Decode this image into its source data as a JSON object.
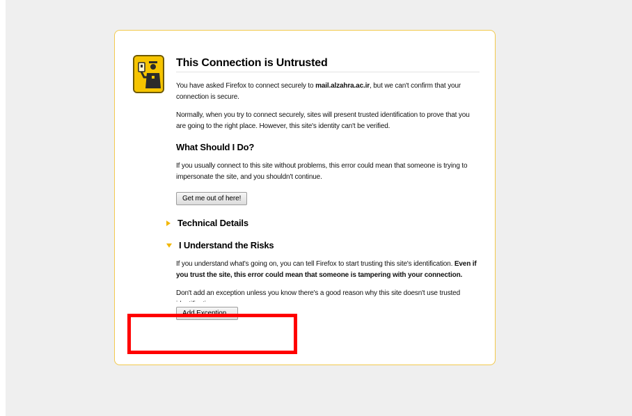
{
  "title": "This Connection is Untrusted",
  "intro": {
    "prefix": "You have asked Firefox to connect securely to ",
    "domain": "mail.alzahra.ac.ir",
    "suffix": ", but we can't confirm that your connection is secure."
  },
  "normally_text": "Normally, when you try to connect securely, sites will present trusted identification to prove that you are going to the right place. However, this site's identity can't be verified.",
  "what_should_heading": "What Should I Do?",
  "what_should_text": "If you usually connect to this site without problems, this error could mean that someone is trying to impersonate the site, and you shouldn't continue.",
  "get_me_out_label": "Get me out of here!",
  "technical_details_label": "Technical Details",
  "understand_risks_label": "I Understand the Risks",
  "risks_text": {
    "plain": "If you understand what's going on, you can tell Firefox to start trusting this site's identification. ",
    "bold": "Even if you trust the site, this error could mean that someone is tampering with your connection."
  },
  "dont_add_text": "Don't add an exception unless you know there's a good reason why this site doesn't use trusted identification.",
  "add_exception_label": "Add Exception...",
  "icon": "security-officer-icon",
  "colors": {
    "accent": "#f2b705",
    "card_border": "#f2c94c",
    "highlight": "#ff0000"
  }
}
